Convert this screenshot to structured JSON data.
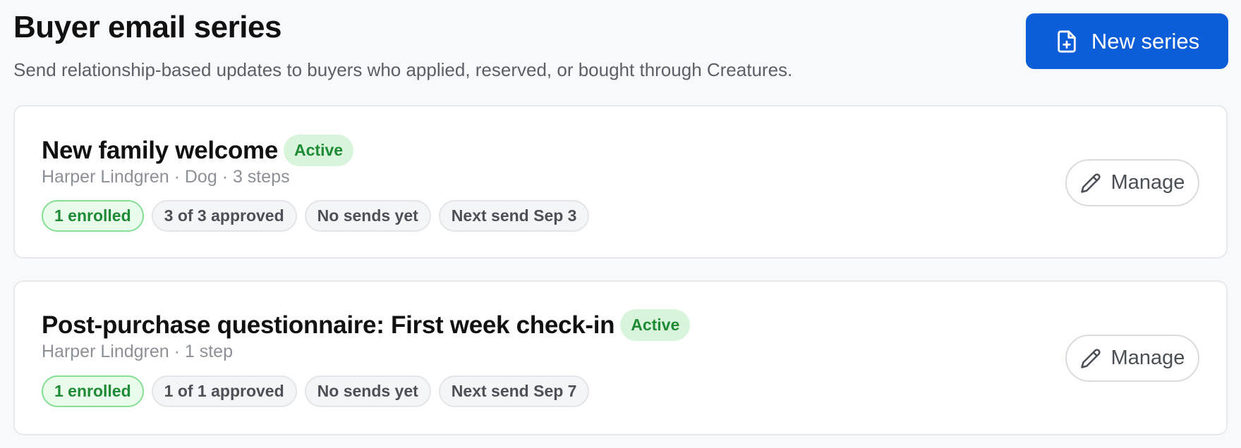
{
  "header": {
    "title": "Buyer email series",
    "subtitle": "Send relationship-based updates to buyers who applied, reserved, or bought through Creatures.",
    "new_series_label": "New series",
    "new_series_icon": "file-plus-icon"
  },
  "colors": {
    "accent": "#0b5ed7",
    "active_badge_bg": "#d8f5dc",
    "active_badge_text": "#1f8a36",
    "background": "#f8f9fb"
  },
  "series": [
    {
      "title": "New family welcome",
      "status": "Active",
      "meta": "Harper Lindgren · Dog · 3 steps",
      "chips": {
        "enrolled": "1 enrolled",
        "approved": "3 of 3 approved",
        "sends": "No sends yet",
        "next_send": "Next send Sep 3"
      },
      "manage_label": "Manage",
      "manage_icon": "pencil-icon"
    },
    {
      "title": "Post-purchase questionnaire: First week check-in",
      "status": "Active",
      "meta": "Harper Lindgren · 1 step",
      "chips": {
        "enrolled": "1 enrolled",
        "approved": "1 of 1 approved",
        "sends": "No sends yet",
        "next_send": "Next send Sep 7"
      },
      "manage_label": "Manage",
      "manage_icon": "pencil-icon"
    }
  ]
}
